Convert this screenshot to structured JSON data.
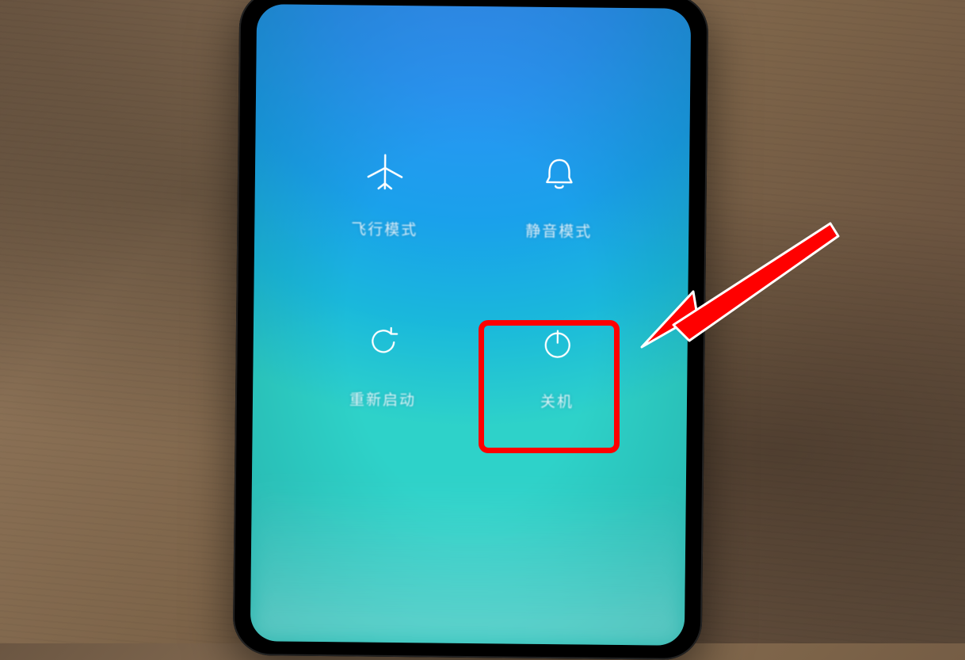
{
  "power_menu": {
    "items": [
      {
        "key": "airplane",
        "label": "飞行模式",
        "icon": "airplane-icon"
      },
      {
        "key": "silent",
        "label": "静音模式",
        "icon": "bell-icon"
      },
      {
        "key": "restart",
        "label": "重新启动",
        "icon": "restart-icon"
      },
      {
        "key": "poweroff",
        "label": "关机",
        "icon": "power-icon"
      }
    ]
  },
  "annotation": {
    "highlight_target": "poweroff",
    "highlight_color": "#ff0000"
  }
}
